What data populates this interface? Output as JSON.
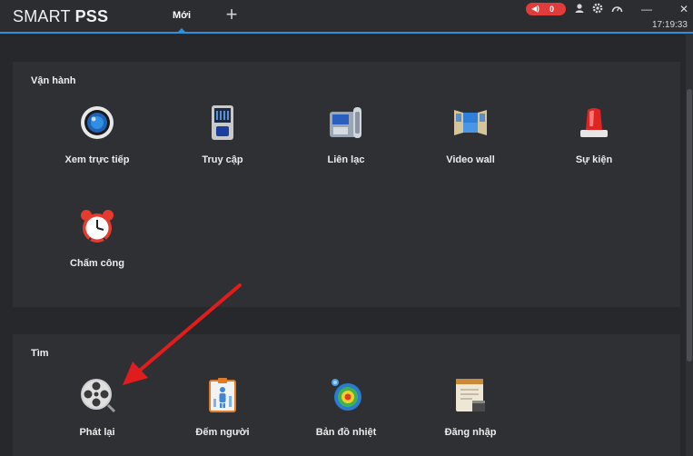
{
  "app": {
    "brand_prefix": "SMART ",
    "brand_bold": "PSS"
  },
  "tabs": [
    {
      "label": "Mới"
    }
  ],
  "toolbar": {
    "alarm_count": "0",
    "clock": "17:19:33",
    "minimize": "—",
    "close": "✕"
  },
  "sections": {
    "operate": {
      "title": "Vận hành",
      "items": [
        {
          "label": "Xem trực tiếp",
          "icon": "camera-lens-icon"
        },
        {
          "label": "Truy cập",
          "icon": "access-control-icon"
        },
        {
          "label": "Liên lạc",
          "icon": "intercom-phone-icon"
        },
        {
          "label": "Video wall",
          "icon": "video-wall-icon"
        },
        {
          "label": "Sự kiện",
          "icon": "alarm-light-icon"
        },
        {
          "label": "Chấm công",
          "icon": "alarm-clock-icon"
        }
      ]
    },
    "search": {
      "title": "Tìm",
      "items": [
        {
          "label": "Phát lại",
          "icon": "film-reel-icon"
        },
        {
          "label": "Đếm người",
          "icon": "people-count-icon"
        },
        {
          "label": "Bản đồ nhiệt",
          "icon": "heat-map-icon"
        },
        {
          "label": "Đăng nhập",
          "icon": "log-notebook-icon"
        }
      ]
    }
  },
  "colors": {
    "accent": "#2f8fd8",
    "alarm": "#e23b3b",
    "annotation_arrow": "#e11c1c"
  }
}
